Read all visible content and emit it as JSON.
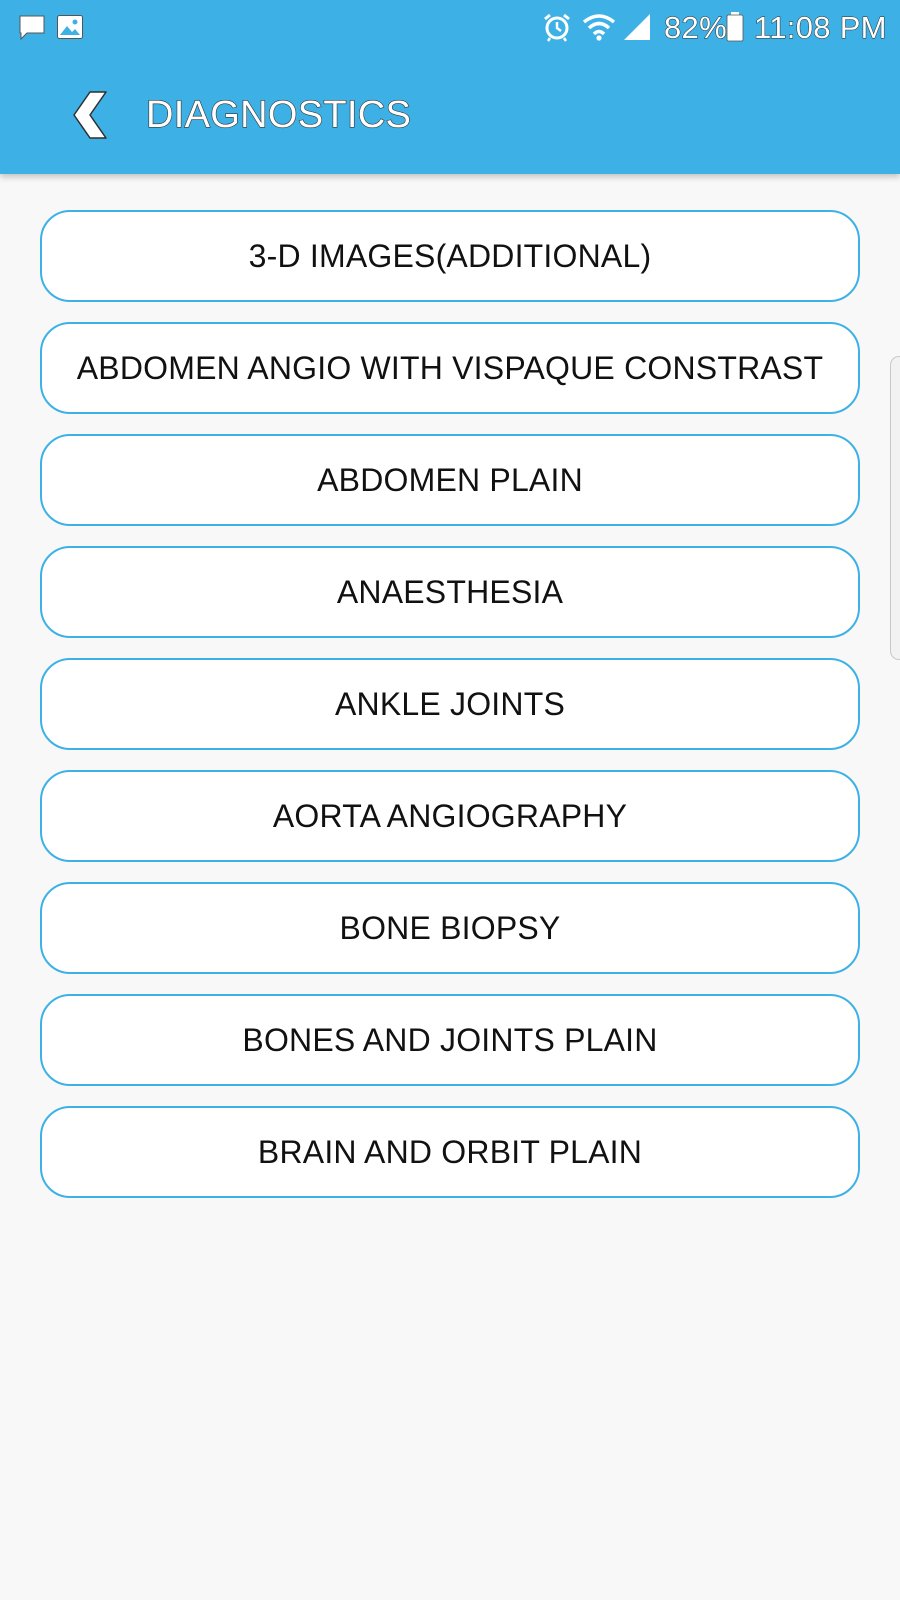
{
  "status_bar": {
    "icons_left": [
      "message-icon",
      "image-icon"
    ],
    "icons_right": [
      "alarm-icon",
      "wifi-icon",
      "signal-icon",
      "battery-icon"
    ],
    "battery": "82%",
    "time": "11:08 PM"
  },
  "header": {
    "back_icon": "chevron-left-icon",
    "title": "DIAGNOSTICS"
  },
  "items": [
    {
      "label": "3-D IMAGES(ADDITIONAL)"
    },
    {
      "label": "ABDOMEN ANGIO WITH VISPAQUE CONSTRAST"
    },
    {
      "label": "ABDOMEN PLAIN"
    },
    {
      "label": "ANAESTHESIA"
    },
    {
      "label": "ANKLE JOINTS"
    },
    {
      "label": "AORTA ANGIOGRAPHY"
    },
    {
      "label": "BONE BIOPSY"
    },
    {
      "label": "BONES AND JOINTS PLAIN"
    },
    {
      "label": "BRAIN AND ORBIT PLAIN"
    }
  ],
  "colors": {
    "accent": "#3db1e5",
    "background": "#f8f8f8",
    "item_text": "#111111"
  }
}
